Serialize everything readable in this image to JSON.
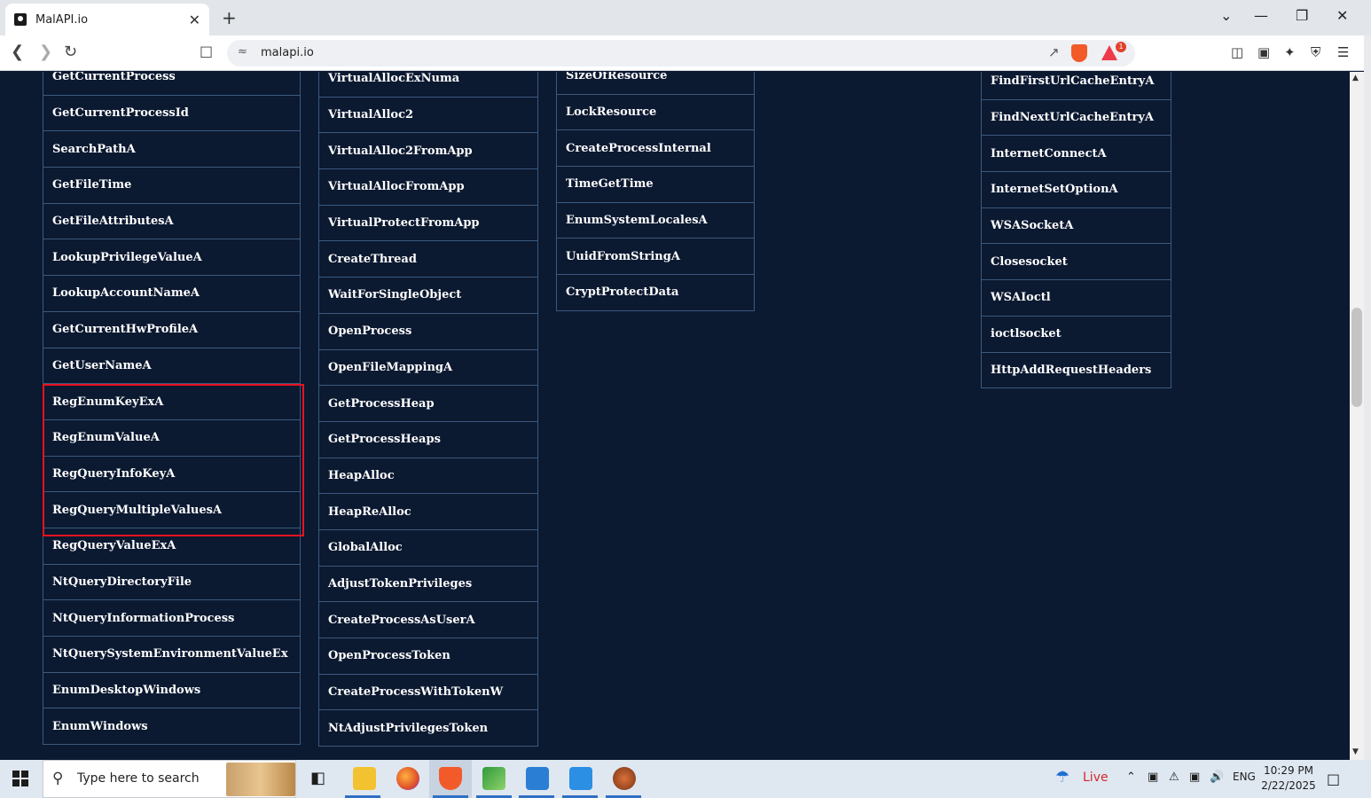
{
  "browser": {
    "tab_title": "MalAPI.io",
    "tab_close": "✕",
    "new_tab": "+",
    "url": "malapi.io",
    "rewards_badge": "1",
    "controls": {
      "dropdown": "⌄",
      "minimize": "—",
      "restore": "❐",
      "close": "✕"
    }
  },
  "columns": [
    {
      "name": "column-1",
      "items": [
        "GetCurrentProcess",
        "GetCurrentProcessId",
        "SearchPathA",
        "GetFileTime",
        "GetFileAttributesA",
        "LookupPrivilegeValueA",
        "LookupAccountNameA",
        "GetCurrentHwProfileA",
        "GetUserNameA",
        "RegEnumKeyExA",
        "RegEnumValueA",
        "RegQueryInfoKeyA",
        "RegQueryMultipleValuesA",
        "RegQueryValueExA",
        "NtQueryDirectoryFile",
        "NtQueryInformationProcess",
        "NtQuerySystemEnvironmentValueEx",
        "EnumDesktopWindows",
        "EnumWindows"
      ]
    },
    {
      "name": "column-2",
      "items": [
        "VirtualAllocExNuma",
        "VirtualAlloc2",
        "VirtualAlloc2FromApp",
        "VirtualAllocFromApp",
        "VirtualProtectFromApp",
        "CreateThread",
        "WaitForSingleObject",
        "OpenProcess",
        "OpenFileMappingA",
        "GetProcessHeap",
        "GetProcessHeaps",
        "HeapAlloc",
        "HeapReAlloc",
        "GlobalAlloc",
        "AdjustTokenPrivileges",
        "CreateProcessAsUserA",
        "OpenProcessToken",
        "CreateProcessWithTokenW",
        "NtAdjustPrivilegesToken"
      ]
    },
    {
      "name": "column-3",
      "items": [
        "SizeOfResource",
        "LockResource",
        "CreateProcessInternal",
        "TimeGetTime",
        "EnumSystemLocalesA",
        "UuidFromStringA",
        "CryptProtectData"
      ]
    },
    {
      "name": "column-5",
      "items": [
        "FindFirstUrlCacheEntryA",
        "FindNextUrlCacheEntryA",
        "InternetConnectA",
        "InternetSetOptionA",
        "WSASocketA",
        "Closesocket",
        "WSAIoctl",
        "ioctlsocket",
        "HttpAddRequestHeaders"
      ]
    }
  ],
  "taskbar": {
    "search_placeholder": "Type here to search",
    "weather_label": "Live",
    "language": "ENG",
    "time": "10:29 PM",
    "date": "2/22/2025"
  },
  "colors": {
    "page_background": "#0b1931",
    "cell_border": "#3b5a7e",
    "highlight_border": "#e8121f"
  }
}
